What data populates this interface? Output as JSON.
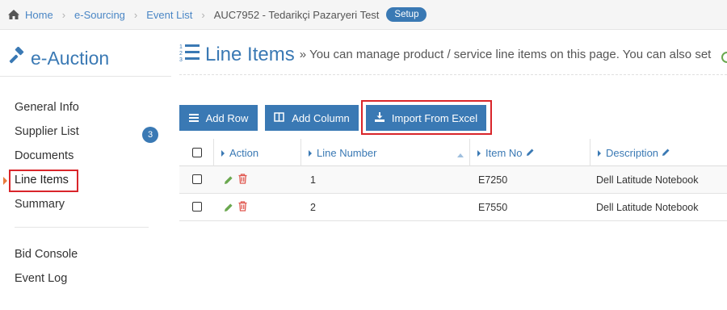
{
  "breadcrumb": {
    "home": "Home",
    "esourcing": "e-Sourcing",
    "event_list": "Event List",
    "current": "AUC7952 - Tedarikçi Pazaryeri Test",
    "badge": "Setup"
  },
  "sidebar": {
    "title": "e-Auction",
    "items": [
      {
        "label": "General Info"
      },
      {
        "label": "Supplier List",
        "badge": "3"
      },
      {
        "label": "Documents"
      },
      {
        "label": "Line Items"
      },
      {
        "label": "Summary"
      },
      {
        "label": "Bid Console"
      },
      {
        "label": "Event Log"
      }
    ],
    "active_item": "Line Items"
  },
  "main": {
    "title": "Line Items",
    "subtitle_sep": "»",
    "subtitle": "You can manage product / service line items on this page. You can also set"
  },
  "toolbar": {
    "add_row": "Add Row",
    "add_column": "Add Column",
    "import_excel": "Import From Excel"
  },
  "table": {
    "headers": {
      "action": "Action",
      "line_number": "Line Number",
      "item_no": "Item No",
      "description": "Description"
    },
    "rows": [
      {
        "line_number": "1",
        "item_no": "E7250",
        "description": "Dell Latitude Notebook"
      },
      {
        "line_number": "2",
        "item_no": "E7550",
        "description": "Dell Latitude Notebook"
      }
    ]
  },
  "colors": {
    "accent": "#3a79b4",
    "highlight": "#d9252a",
    "edit_icon": "#6aa84f",
    "delete_icon": "#e0574f"
  },
  "icons": [
    "home-icon",
    "gavel-icon",
    "list-ordered-icon",
    "bars-icon",
    "columns-icon",
    "download-icon",
    "pencil-icon",
    "trash-icon"
  ]
}
